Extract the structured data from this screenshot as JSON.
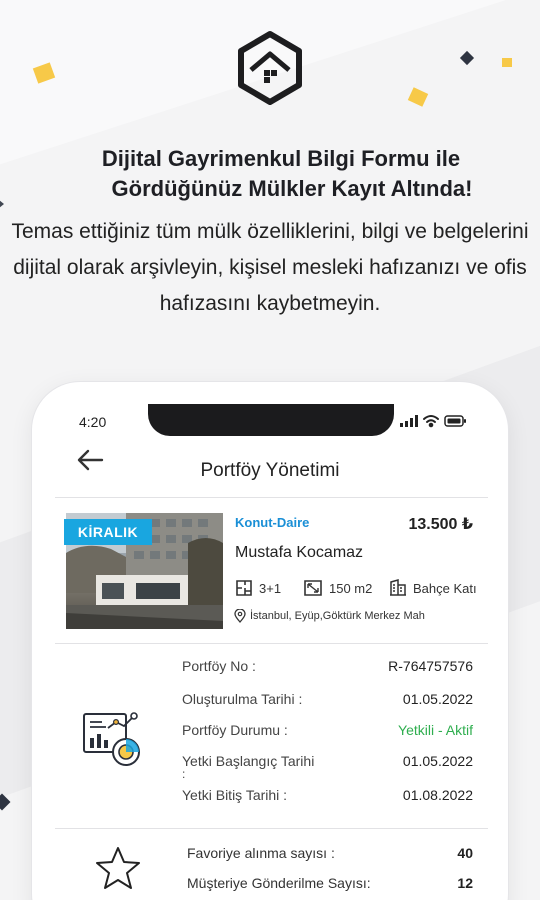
{
  "colors": {
    "accent": "#19a6e0",
    "status_green": "#2fae4f",
    "deco_yellow": "#f7c948",
    "deco_navy": "#2e3441"
  },
  "headline": {
    "line1": "Dijital Gayrimenkul Bilgi Formu ile",
    "line2": "Gördüğünüz Mülkler Kayıt Altında!"
  },
  "subtext": "Temas ettiğiniz tüm mülk özelliklerini, bilgi ve belgelerini dijital olarak arşivleyin, kişisel mesleki hafızanızı ve ofis hafızasını kaybetmeyin.",
  "phone": {
    "time": "4:20",
    "screen_title": "Portföy Yönetimi",
    "listing": {
      "badge": "KİRALIK",
      "type": "Konut-Daire",
      "price": "13.500 ₺",
      "owner": "Mustafa Kocamaz",
      "rooms": "3+1",
      "area": "150 m2",
      "floor": "Bahçe Katı",
      "location": "İstanbul, Eyüp,Göktürk Merkez Mah"
    },
    "info": [
      {
        "label": "Portföy No :",
        "value": "R-764757576"
      },
      {
        "label": "Oluşturulma Tarihi :",
        "value": "01.05.2022"
      },
      {
        "label": "Portföy Durumu :",
        "value": "Yetkili - Aktif"
      },
      {
        "label": "Yetki Başlangıç Tarihi",
        "label_cont": ":",
        "value": "01.05.2022"
      },
      {
        "label": "Yetki Bitiş Tarihi :",
        "value": "01.08.2022"
      }
    ],
    "stats": [
      {
        "label": "Favoriye alınma sayısı :",
        "value": "40"
      },
      {
        "label": "Müşteriye Gönderilme Sayısı:",
        "value": "12"
      }
    ]
  }
}
